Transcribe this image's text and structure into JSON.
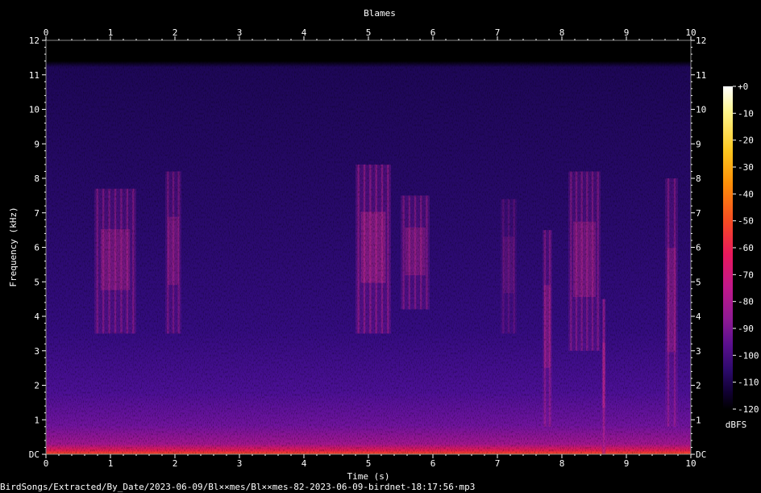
{
  "chart_data": {
    "type": "heatmap",
    "title": "Blames",
    "xlabel": "Time (s)",
    "ylabel": "Frequency (kHz)",
    "xlim": [
      0,
      10
    ],
    "ylim": [
      0,
      12
    ],
    "x_ticks": [
      "0",
      "1",
      "2",
      "3",
      "4",
      "5",
      "6",
      "7",
      "8",
      "9",
      "10"
    ],
    "y_ticks": [
      "DC",
      "1",
      "2",
      "3",
      "4",
      "5",
      "6",
      "7",
      "8",
      "9",
      "10",
      "11",
      "12"
    ],
    "colorbar": {
      "label": "dBFS",
      "range": [
        -120,
        0
      ],
      "ticks": [
        "+0",
        "-10",
        "-20",
        "-30",
        "-40",
        "-50",
        "-60",
        "-70",
        "-80",
        "-90",
        "-100",
        "-110",
        "-120"
      ],
      "colors": [
        "#000000",
        "#100030",
        "#2c0a6b",
        "#5a0f8e",
        "#8f1a94",
        "#c2188a",
        "#e8185c",
        "#f54a23",
        "#fd8f08",
        "#fdc61f",
        "#fef48a",
        "#ffffff"
      ]
    },
    "background_noise_top_khz": 11.5,
    "energy": [
      {
        "t": [
          0.75,
          1.4
        ],
        "f": [
          3.5,
          7.7
        ],
        "level": 0.55
      },
      {
        "t": [
          1.85,
          2.1
        ],
        "f": [
          3.5,
          8.2
        ],
        "level": 0.5
      },
      {
        "t": [
          4.8,
          5.35
        ],
        "f": [
          3.5,
          8.4
        ],
        "level": 0.65
      },
      {
        "t": [
          5.5,
          5.95
        ],
        "f": [
          4.2,
          7.5
        ],
        "level": 0.55
      },
      {
        "t": [
          7.05,
          7.3
        ],
        "f": [
          3.5,
          7.4
        ],
        "level": 0.3
      },
      {
        "t": [
          7.7,
          7.85
        ],
        "f": [
          0.8,
          6.5
        ],
        "level": 0.55
      },
      {
        "t": [
          8.1,
          8.6
        ],
        "f": [
          3.0,
          8.2
        ],
        "level": 0.55
      },
      {
        "t": [
          8.62,
          8.68
        ],
        "f": [
          0.0,
          4.5
        ],
        "level": 0.7
      },
      {
        "t": [
          9.6,
          9.8
        ],
        "f": [
          0.8,
          8.0
        ],
        "level": 0.55
      }
    ]
  },
  "footer": {
    "path": "BirdSongs/Extracted/By_Date/2023-06-09/Bl××mes/Bl××mes-82-2023-06-09-birdnet-18:17:56·mp3"
  }
}
